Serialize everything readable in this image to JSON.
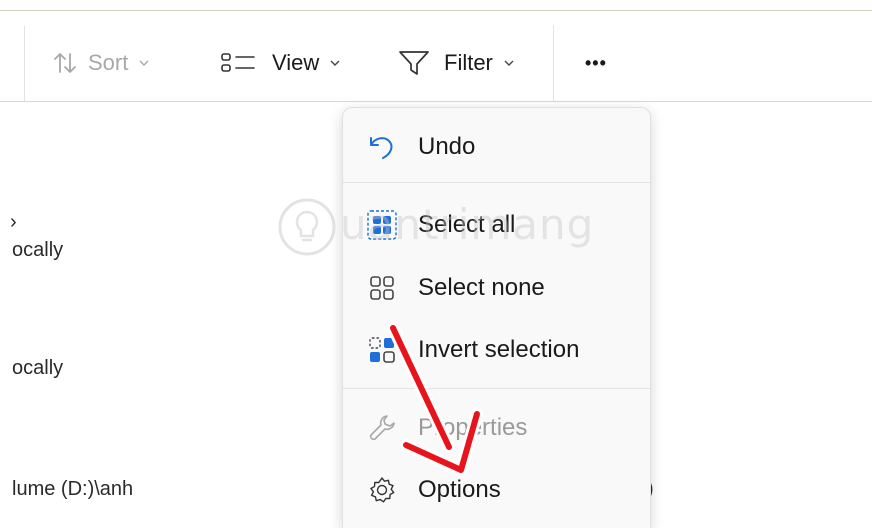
{
  "toolbar": {
    "sort_label": "Sort",
    "view_label": "View",
    "filter_label": "Filter",
    "more_label": "•••"
  },
  "background_items": [
    {
      "text": "ocally"
    },
    {
      "text": "ocally"
    },
    {
      "text": "lume (D:)\\anh"
    }
  ],
  "menu": {
    "undo": "Undo",
    "select_all": "Select all",
    "select_none": "Select none",
    "invert_selection": "Invert selection",
    "properties": "Properties",
    "options": "Options"
  },
  "watermark": {
    "text": "uantrimang"
  },
  "colors": {
    "accent": "#1e6fd9",
    "arrow": "#e8141b",
    "disabled": "#a8a8a8"
  }
}
